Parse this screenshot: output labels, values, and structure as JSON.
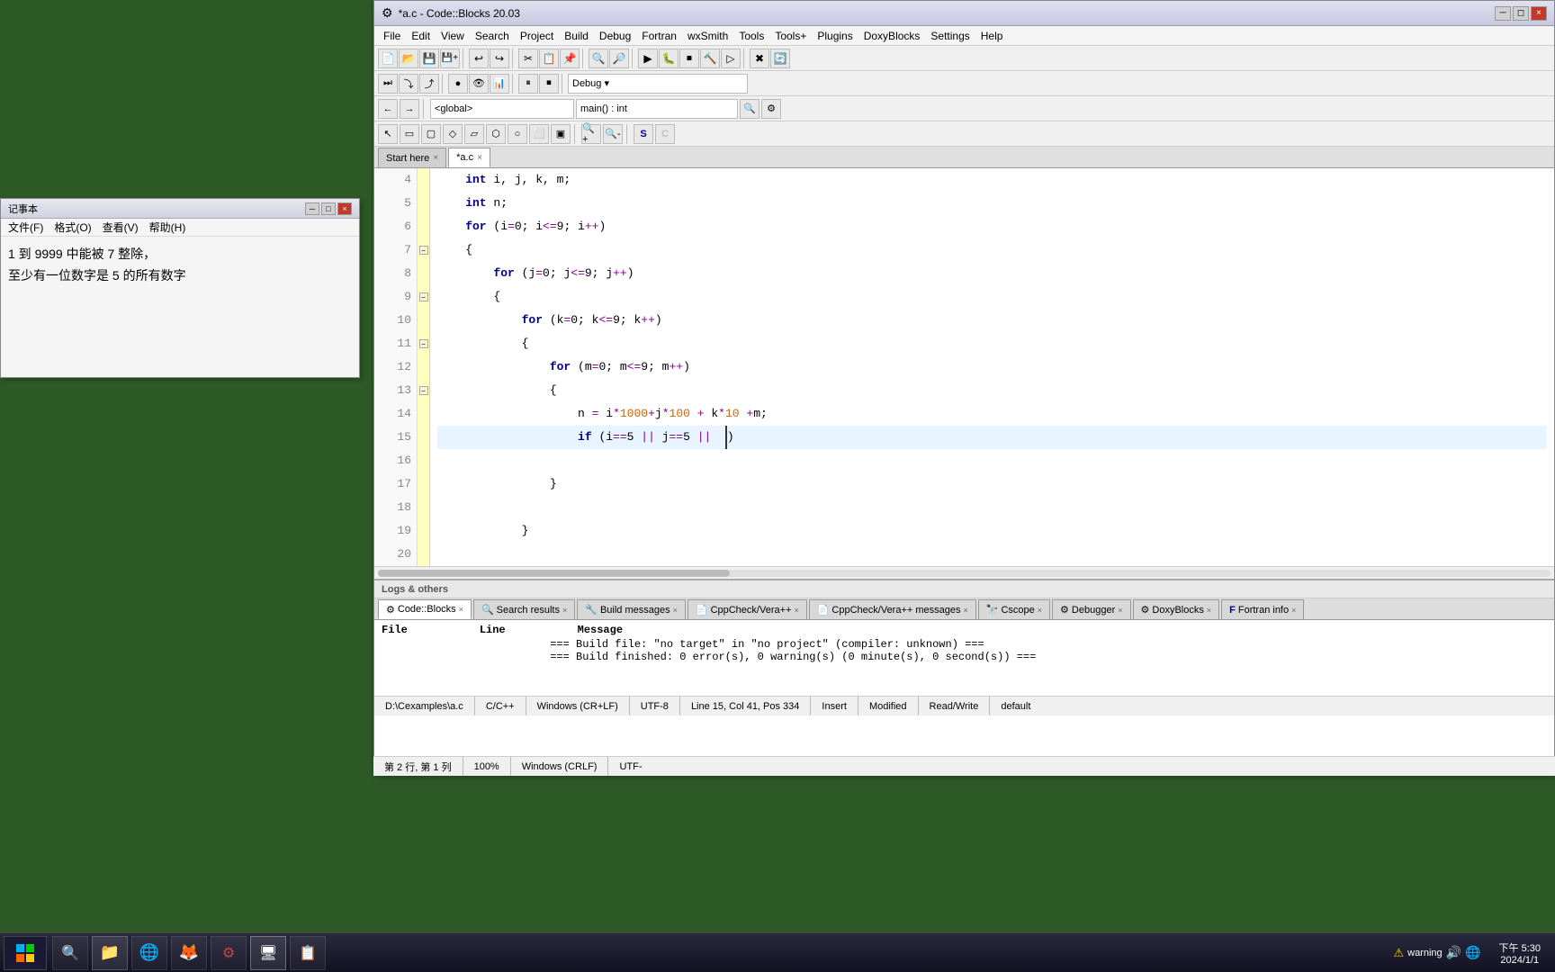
{
  "notepad": {
    "title": "记事本",
    "menu": [
      "文件(F)",
      "格式(O)",
      "查看(V)",
      "帮助(H)"
    ],
    "content_line1": "1 到 9999 中能被 7 整除，",
    "content_line2": "至少有一位数字是 5 的所有数字"
  },
  "ide": {
    "title": "*a.c - Code::Blocks 20.03",
    "menu_items": [
      "File",
      "Edit",
      "View",
      "Search",
      "Project",
      "Build",
      "Debug",
      "Fortran",
      "wxSmith",
      "Tools",
      "Tools+",
      "Plugins",
      "DoxyBlocks",
      "Settings",
      "Help"
    ],
    "tabs": [
      {
        "label": "Start here",
        "active": false,
        "modified": false
      },
      {
        "label": "*a.c",
        "active": true,
        "modified": true
      }
    ],
    "global_dropdown": "<global>",
    "scope_dropdown": "main() : int",
    "code_lines": [
      {
        "num": 4,
        "content": "    int i, j, k, m;"
      },
      {
        "num": 5,
        "content": "    int n;"
      },
      {
        "num": 6,
        "content": "    for (i=0; i<=9; i++)"
      },
      {
        "num": 7,
        "content": "    {"
      },
      {
        "num": 8,
        "content": "        for (j=0; j<=9; j++)"
      },
      {
        "num": 9,
        "content": "        {"
      },
      {
        "num": 10,
        "content": "            for (k=0; k<=9; k++)"
      },
      {
        "num": 11,
        "content": "            {"
      },
      {
        "num": 12,
        "content": "                for (m=0; m<=9; m++)"
      },
      {
        "num": 13,
        "content": "                {"
      },
      {
        "num": 14,
        "content": "                    n = i*1000+j*100 + k*10 +m;"
      },
      {
        "num": 15,
        "content": "                    if (i==5 || j==5 || )"
      },
      {
        "num": 16,
        "content": ""
      },
      {
        "num": 17,
        "content": "                }"
      },
      {
        "num": 18,
        "content": ""
      },
      {
        "num": 19,
        "content": "            }"
      },
      {
        "num": 20,
        "content": ""
      }
    ],
    "logs": {
      "title": "Logs & others",
      "tabs": [
        {
          "label": "Code::Blocks",
          "icon": "⚙",
          "active": true
        },
        {
          "label": "Search results",
          "icon": "🔍",
          "active": false
        },
        {
          "label": "Build messages",
          "icon": "🔧",
          "active": false
        },
        {
          "label": "CppCheck/Vera++",
          "icon": "📄",
          "active": false
        },
        {
          "label": "CppCheck/Vera++ messages",
          "icon": "📄",
          "active": false
        },
        {
          "label": "Cscope",
          "icon": "🔭",
          "active": false
        },
        {
          "label": "Debugger",
          "icon": "⚙",
          "active": false
        },
        {
          "label": "DoxyBlocks",
          "icon": "⚙",
          "active": false
        },
        {
          "label": "Fortran info",
          "icon": "F",
          "active": false
        }
      ],
      "columns": [
        "File",
        "Line",
        "Message"
      ],
      "messages": [
        "=== Build file: \"no target\" in \"no project\" (compiler: unknown) ===",
        "=== Build finished: 0 error(s), 0 warning(s) (0 minute(s), 0 second(s)) ==="
      ]
    },
    "status": {
      "filepath": "D:\\Cexamples\\a.c",
      "language": "C/C++",
      "line_ending": "Windows (CR+LF)",
      "encoding": "UTF-8",
      "position": "Line 15, Col 41, Pos 334",
      "mode": "Insert",
      "modified": "Modified",
      "access": "Read/Write",
      "style": "default"
    },
    "chinese_status": {
      "left": "第 2 行, 第 1 列",
      "zoom": "100%",
      "line_ending": "Windows (CRLF)",
      "encoding": "UTF-"
    }
  },
  "taskbar": {
    "items": [
      "⊞",
      "📁",
      "🌐",
      "🦊",
      "🎯",
      "🖥",
      "📋"
    ],
    "tray_items": [
      "warning",
      "🔊",
      "🌐"
    ],
    "time": "下午 5:30",
    "date": "2024/1/1"
  }
}
